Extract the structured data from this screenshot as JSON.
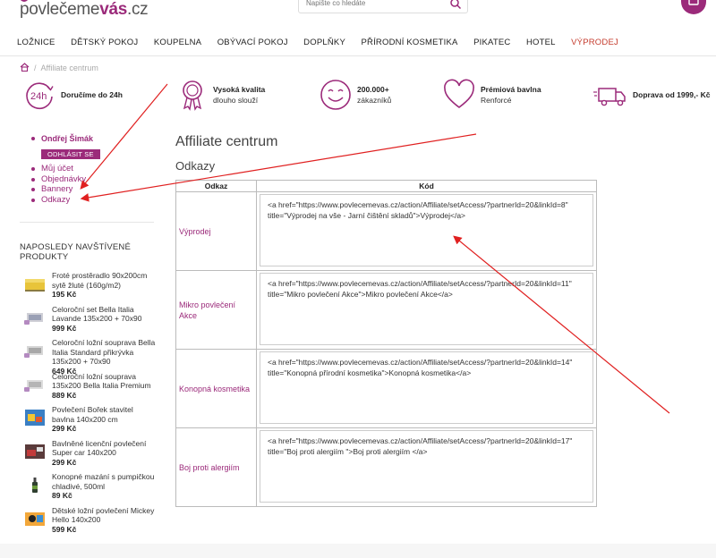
{
  "header": {
    "logo_main": "povlečeme",
    "logo_accent": "vás",
    "logo_tld": ".cz",
    "search_placeholder": "Napište co hledáte"
  },
  "nav": [
    "LOŽNICE",
    "DĚTSKÝ POKOJ",
    "KOUPELNA",
    "OBÝVACÍ POKOJ",
    "DOPLŇKY",
    "PŘÍRODNÍ KOSMETIKA",
    "PIKATEC",
    "HOTEL",
    "VÝPRODEJ"
  ],
  "breadcrumb": {
    "separator": "/",
    "current": "Affiliate centrum"
  },
  "benefits": [
    {
      "icon": "24h-icon",
      "line1": "Doručíme do 24h",
      "line2": ""
    },
    {
      "icon": "quality-medal-icon",
      "line1": "Vysoká kvalita",
      "line2": "dlouho slouží"
    },
    {
      "icon": "smiley-icon",
      "line1": "200.000+",
      "line2": "zákazníků"
    },
    {
      "icon": "heart-icon",
      "line1": "Prémiová bavlna",
      "line2": "Renforcé"
    },
    {
      "icon": "truck-icon",
      "line1": "Doprava od 1999,- Kč",
      "line2": ""
    }
  ],
  "sidebar": {
    "user_name": "Ondřej Šimák",
    "logout_label": "ODHLÁSIT SE",
    "menu": [
      "Můj účet",
      "Objednávky",
      "Bannery",
      "Odkazy"
    ],
    "recent_title": "NAPOSLEDY NAVŠTÍVENÉ PRODUKTY",
    "recent": [
      {
        "name": "Froté prostěradlo 90x200cm sytě žluté (160g/m2)",
        "price": "195 Kč"
      },
      {
        "name": "Celoroční set Bella Italia Lavande 135x200 + 70x90",
        "price": "999 Kč"
      },
      {
        "name": "Celoroční ložní souprava Bella Italia Standard přikrývka 135x200 + 70x90",
        "price": "649 Kč"
      },
      {
        "name": "Celoroční ložní souprava 135x200 Bella Italia Premium",
        "price": "889 Kč"
      },
      {
        "name": "Povlečení Bořek stavitel bavlna 140x200 cm",
        "price": "299 Kč"
      },
      {
        "name": "Bavlněné licenční povlečení Super car 140x200",
        "price": "299 Kč"
      },
      {
        "name": "Konopné mazání s pumpičkou chladivé, 500ml",
        "price": "89 Kč"
      },
      {
        "name": "Dětské ložní povlečení Mickey Hello 140x200",
        "price": "599 Kč"
      }
    ]
  },
  "main": {
    "title": "Affiliate centrum",
    "section": "Odkazy",
    "col_name": "Odkaz",
    "col_code": "Kód",
    "rows": [
      {
        "name": "Výprodej",
        "code": "<a href=\"https://www.povlecemevas.cz/action/Affiliate/setAccess/?partnerId=20&linkId=8\" title=\"Výprodej na vše - Jarní čištění skladů\">Výprodej</a>"
      },
      {
        "name": "Mikro povlečení Akce",
        "code": "<a href=\"https://www.povlecemevas.cz/action/Affiliate/setAccess/?partnerId=20&linkId=11\" title=\"Mikro povlečení Akce\">Mikro povlečení Akce</a>"
      },
      {
        "name": "Konopná kosmetika",
        "code": "<a href=\"https://www.povlecemevas.cz/action/Affiliate/setAccess/?partnerId=20&linkId=14\" title=\"Konopná přírodní kosmetika\">Konopná kosmetika</a>"
      },
      {
        "name": "Boj proti alergiím",
        "code": "<a href=\"https://www.povlecemevas.cz/action/Affiliate/setAccess/?partnerId=20&linkId=17\" title=\"Boj proti alergiím \">Boj proti alergiím </a>"
      }
    ]
  },
  "colors": {
    "brand": "#9b2a7a",
    "sale": "#c53c2e",
    "annotation": "#e02020"
  }
}
